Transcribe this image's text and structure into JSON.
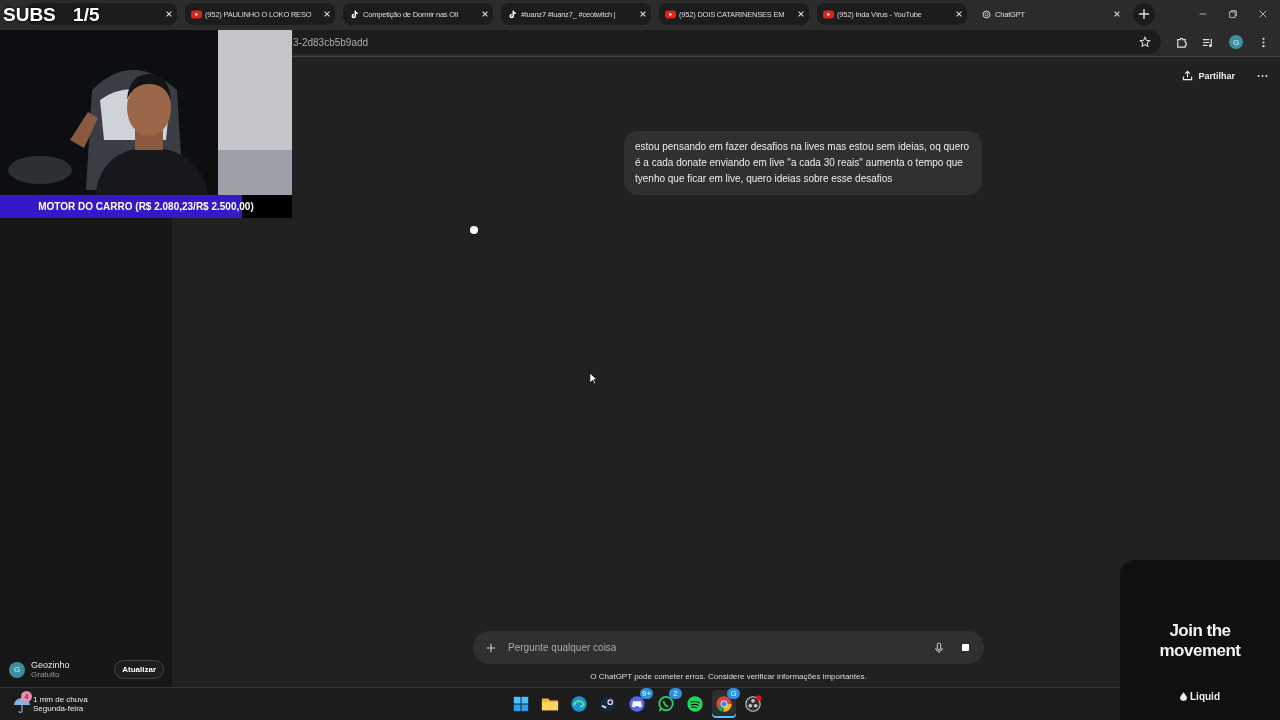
{
  "browser": {
    "tabs": [
      {
        "selected": false
      },
      {
        "kind": "youtube",
        "title": "(952) PAULINHO O LOKO RESO",
        "selected": false
      },
      {
        "kind": "tiktok",
        "title": "Competição de Dormir nas Oli",
        "selected": false
      },
      {
        "kind": "tiktok",
        "title": "#luanz7 #luanz7_ #ceotwitch |",
        "selected": false
      },
      {
        "kind": "youtube",
        "title": "(952) DOIS CATARINENSES EM",
        "selected": false
      },
      {
        "kind": "youtube",
        "title": "(952) Inda Vírus - YouTube",
        "selected": false
      },
      {
        "kind": "chatgpt",
        "title": "ChatGPT",
        "selected": true
      }
    ],
    "address": "3-2d83cb5b9add",
    "profile_initial": "G"
  },
  "sidebar": {
    "user": {
      "initial": "G",
      "name": "Geozinho",
      "plan": "Gratuito"
    },
    "upgrade": "Atualizar"
  },
  "chat": {
    "share": "Partilhar",
    "messages": [
      {
        "text": "estou pensando em fazer desafios na lives mas estou sem ideias, oq quero é a cada donate enviando em live \"a cada 30 reais\" aumenta o tempo que tyenho que ficar em live, quero ideias sobre esse desafios"
      }
    ],
    "placeholder": "Pergunte qualquer coisa",
    "disclaimer": "O ChatGPT pode cometer erros. Considere verificar informações importantes."
  },
  "taskbar": {
    "weather": {
      "badge": "4",
      "line1": "1 mm de chuva",
      "line2": "Segunda-feira"
    },
    "apps": [
      {
        "kind": "start",
        "selected": false
      },
      {
        "kind": "files",
        "selected": false
      },
      {
        "kind": "edge",
        "selected": false
      },
      {
        "kind": "steam",
        "selected": false
      },
      {
        "kind": "discord",
        "badge": "9+",
        "selected": false
      },
      {
        "kind": "whatsapp",
        "badge": "2",
        "selected": false
      },
      {
        "kind": "spotify",
        "selected": false
      },
      {
        "kind": "chrome",
        "badge": "G",
        "selected": true
      },
      {
        "kind": "obs",
        "selected": false
      }
    ]
  },
  "stream_overlay": {
    "counter": "SUBS 1/5",
    "goal": {
      "label": "MOTOR DO CARRO (R$ 2.080,23/R$ 2.500,00)",
      "level": 0.83
    }
  },
  "ad": {
    "headline": "Join the movement",
    "brand": "Liquid"
  }
}
